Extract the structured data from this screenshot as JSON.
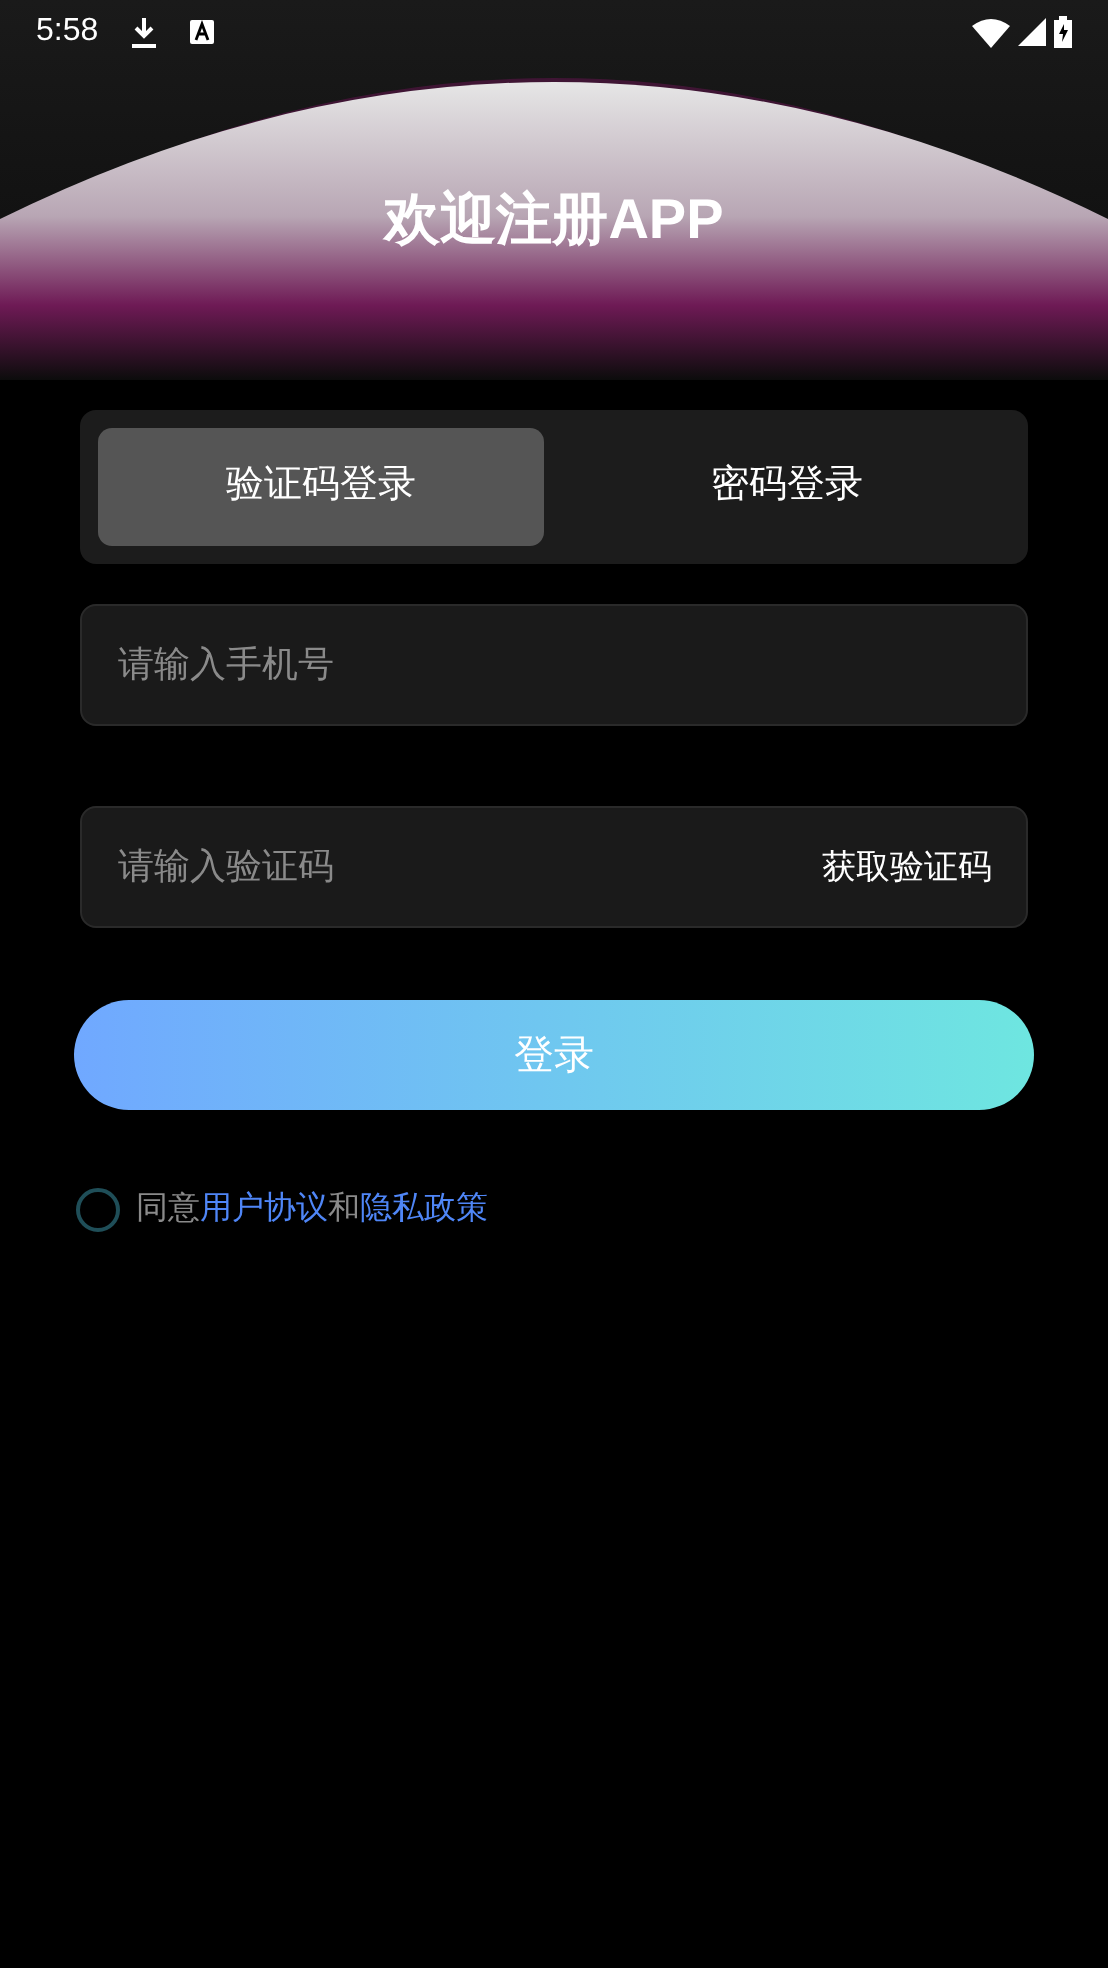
{
  "status_bar": {
    "time": "5:58"
  },
  "title": "欢迎注册APP",
  "tabs": [
    {
      "label": "验证码登录",
      "selected": true
    },
    {
      "label": "密码登录",
      "selected": false
    }
  ],
  "phone_field": {
    "placeholder": "请输入手机号"
  },
  "code_field": {
    "placeholder": "请输入验证码",
    "action": "获取验证码"
  },
  "login_button": "登录",
  "agreement": {
    "checked": false,
    "parts": [
      {
        "kind": "text",
        "text": "同意"
      },
      {
        "kind": "link",
        "text": "用户协议"
      },
      {
        "kind": "text",
        "text": "和"
      },
      {
        "kind": "link",
        "text": "隐私政策"
      }
    ]
  }
}
